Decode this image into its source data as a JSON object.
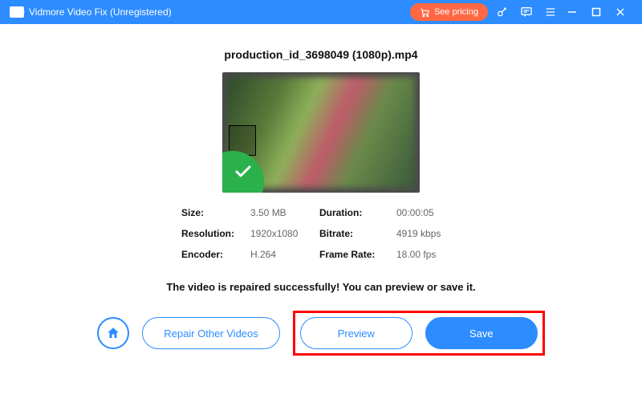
{
  "titlebar": {
    "app_title": "Vidmore Video Fix (Unregistered)",
    "pricing_label": "See pricing"
  },
  "file": {
    "name": "production_id_3698049 (1080p).mp4"
  },
  "meta": {
    "size_label": "Size:",
    "size_value": "3.50 MB",
    "duration_label": "Duration:",
    "duration_value": "00:00:05",
    "resolution_label": "Resolution:",
    "resolution_value": "1920x1080",
    "bitrate_label": "Bitrate:",
    "bitrate_value": "4919 kbps",
    "encoder_label": "Encoder:",
    "encoder_value": "H.264",
    "framerate_label": "Frame Rate:",
    "framerate_value": "18.00 fps"
  },
  "status": {
    "message": "The video is repaired successfully! You can preview or save it."
  },
  "actions": {
    "repair_other": "Repair Other Videos",
    "preview": "Preview",
    "save": "Save"
  }
}
